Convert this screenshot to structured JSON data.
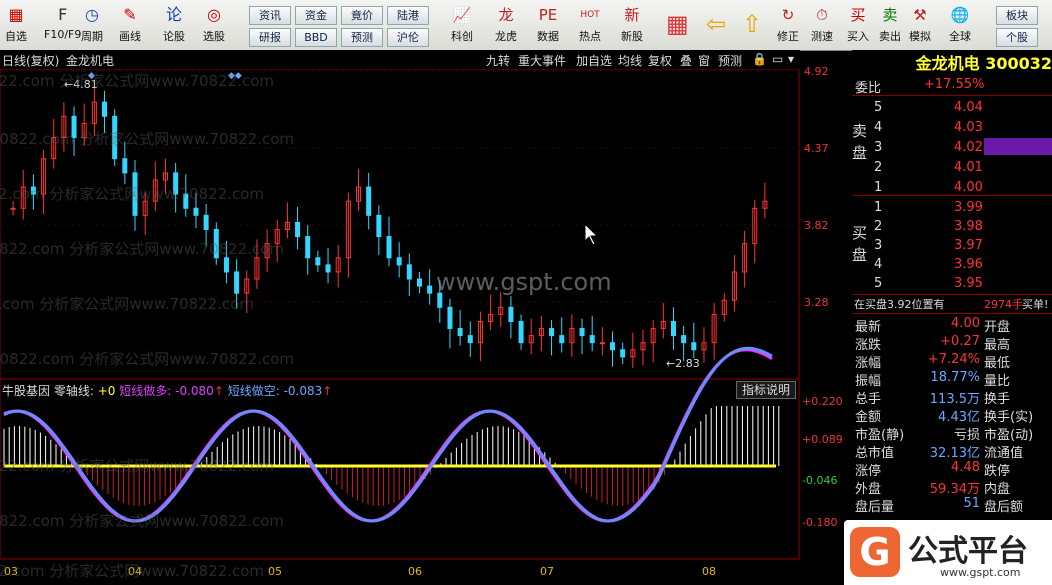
{
  "toolbar": {
    "left_buttons": [
      {
        "label": "自选",
        "icon": "grid-icon"
      },
      {
        "label": "F10/F9",
        "icon": "f10-icon"
      },
      {
        "label": "周期",
        "icon": "clock-icon"
      },
      {
        "label": "画线",
        "icon": "pencil-icon"
      },
      {
        "label": "论股",
        "icon": "chat-icon"
      },
      {
        "label": "选股",
        "icon": "chart-search-icon"
      }
    ],
    "pills_row1": [
      "资讯",
      "资金",
      "竟价",
      "陆港"
    ],
    "pills_row2": [
      "研报",
      "BBD",
      "预测",
      "沪伦"
    ],
    "right_buttons": [
      {
        "label": "科创",
        "icon": "tech-icon"
      },
      {
        "label": "龙虎",
        "icon": "dragon-icon"
      },
      {
        "label": "数据",
        "icon": "pe-icon"
      },
      {
        "label": "热点",
        "icon": "hot-icon"
      },
      {
        "label": "新股",
        "icon": "newstock-icon"
      },
      {
        "label": "修正",
        "icon": "refresh-icon"
      },
      {
        "label": "测速",
        "icon": "timer-icon"
      },
      {
        "label": "买入",
        "icon": "buy-icon"
      },
      {
        "label": "卖出",
        "icon": "sell-icon"
      },
      {
        "label": "模拟",
        "icon": "hammer-icon"
      },
      {
        "label": "全球",
        "icon": "globe-icon"
      }
    ],
    "far_right": [
      "板块",
      "个股"
    ]
  },
  "chart_header": {
    "period": "日线(复权)",
    "stock": "金龙机电",
    "buttons": [
      "九转",
      "重大事件",
      "加自选",
      "均线",
      "复权",
      "叠",
      "窗",
      "预测"
    ]
  },
  "price_axis": [
    "4.92",
    "4.37",
    "3.82",
    "3.28"
  ],
  "price_annotations": {
    "high": "4.81",
    "low": "2.83"
  },
  "indicator_header": {
    "name": "牛股基因",
    "zero_label": "零轴线:",
    "zero_value": "+0",
    "long_label": "短线做多:",
    "long_value": "-0.080",
    "short_label": "短线做空:",
    "short_value": "-0.083",
    "help": "指标说明"
  },
  "indicator_axis": [
    "+0.220",
    "+0.089",
    "-0.046",
    "-0.180"
  ],
  "x_axis": [
    "03",
    "04",
    "05",
    "06",
    "07",
    "08"
  ],
  "watermarks": [
    "70822.com 分析家公式网www.70822.com",
    "www.gspt.com"
  ],
  "quote": {
    "title": "金龙机电 300032",
    "webi_label": "委比",
    "webi_value": "+17.55%",
    "sell_label": "卖盘",
    "buy_label": "买盘",
    "sell": [
      {
        "lvl": "5",
        "price": "4.04"
      },
      {
        "lvl": "4",
        "price": "4.03"
      },
      {
        "lvl": "3",
        "price": "4.02"
      },
      {
        "lvl": "2",
        "price": "4.01"
      },
      {
        "lvl": "1",
        "price": "4.00"
      }
    ],
    "buy": [
      {
        "lvl": "1",
        "price": "3.99"
      },
      {
        "lvl": "2",
        "price": "3.98"
      },
      {
        "lvl": "3",
        "price": "3.97"
      },
      {
        "lvl": "4",
        "price": "3.96"
      },
      {
        "lvl": "5",
        "price": "3.95"
      }
    ],
    "status_left": "在买盘3.92位置有",
    "status_vol": "2974手",
    "status_right": "买单!",
    "stats": [
      {
        "k": "最新",
        "v": "4.00",
        "k2": "开盘"
      },
      {
        "k": "涨跌",
        "v": "+0.27",
        "k2": "最高"
      },
      {
        "k": "涨幅",
        "v": "+7.24%",
        "k2": "最低"
      },
      {
        "k": "振幅",
        "v": "18.77%",
        "k2": "量比"
      },
      {
        "k": "总手",
        "v": "113.5万",
        "k2": "换手"
      },
      {
        "k": "金额",
        "v": "4.43亿",
        "k2": "换手(实)"
      },
      {
        "k": "市盈(静)",
        "v": "亏损",
        "k2": "市盈(动)"
      },
      {
        "k": "总市值",
        "v": "32.13亿",
        "k2": "流通值"
      },
      {
        "k": "涨停",
        "v": "4.48",
        "k2": "跌停"
      },
      {
        "k": "外盘",
        "v": "59.34万",
        "k2": "内盘"
      },
      {
        "k": "盘后量",
        "v": "51",
        "k2": "盘后额"
      }
    ]
  },
  "logo": {
    "text": "公式平台",
    "url": "www.gspt.com"
  },
  "colors": {
    "up": "#ff3333",
    "down": "#33d6ff",
    "ma": "#ffff33"
  }
}
